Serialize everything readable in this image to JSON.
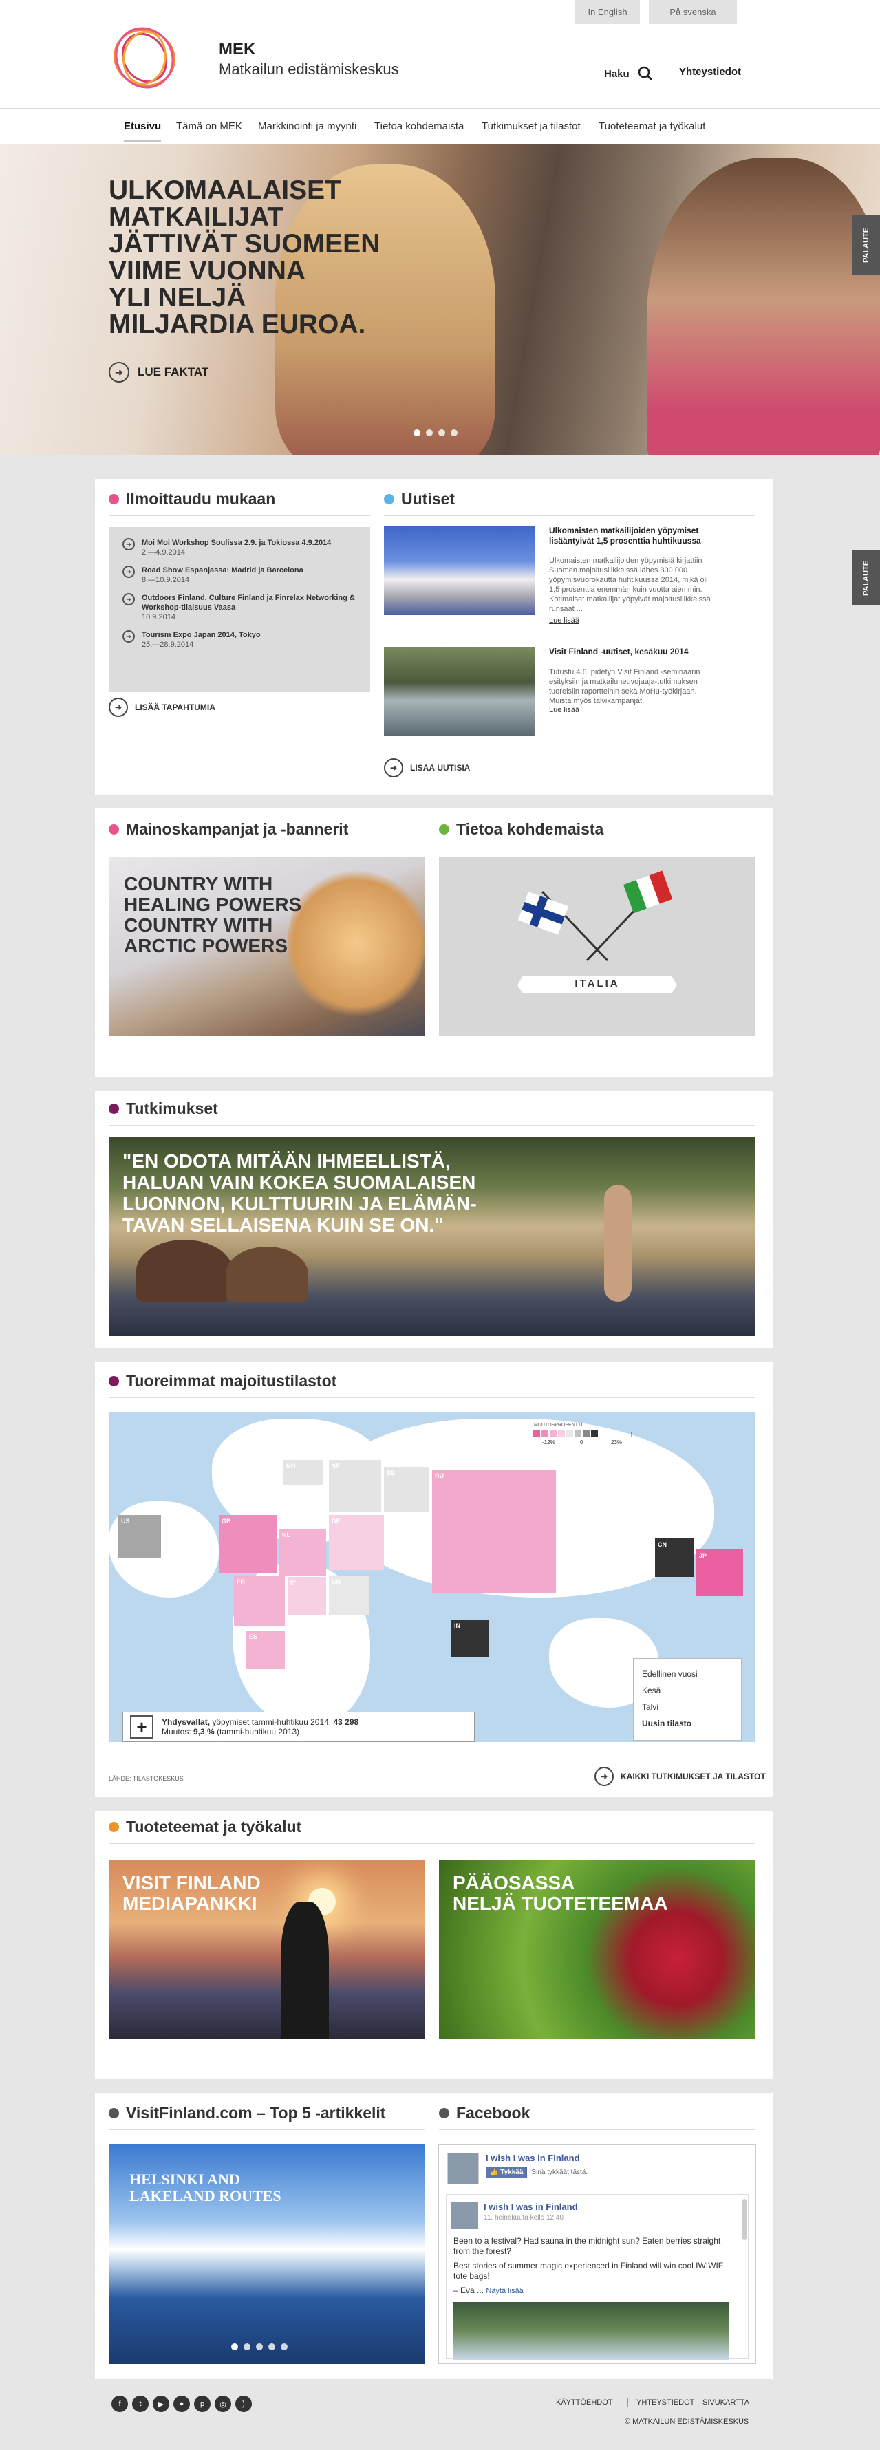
{
  "lang": {
    "english": "In English",
    "swedish": "På svenska"
  },
  "brand": {
    "name": "MEK",
    "tagline": "Matkailun edistämiskeskus"
  },
  "header": {
    "search_label": "Haku",
    "contact_label": "Yhteystiedot"
  },
  "nav": [
    "Etusivu",
    "Tämä on MEK",
    "Markkinointi ja myynti",
    "Tietoa kohdemaista",
    "Tutkimukset ja tilastot",
    "Tuoteteemat ja työkalut"
  ],
  "hero": {
    "title": "ULKOMAALAISET\nMATKAILIJAT\nJÄTTIVÄT SUOMEEN\nVIIME VUONNA\nYLI NELJÄ\nMILJARDIA EUROA.",
    "cta": "LUE FAKTAT"
  },
  "feedback_label": "PALAUTE",
  "events": {
    "title": "Ilmoittaudu mukaan",
    "items": [
      {
        "title": "Moi Moi Workshop Soulissa 2.9. ja Tokiossa 4.9.2014",
        "date": "2.—4.9.2014"
      },
      {
        "title": "Road Show Espanjassa: Madrid ja Barcelona",
        "date": "8.—10.9.2014"
      },
      {
        "title": "Outdoors Finland, Culture Finland ja Finrelax Networking & Workshop-tilaisuus Vaasa",
        "date": "10.9.2014"
      },
      {
        "title": "Tourism Expo Japan 2014, Tokyo",
        "date": "25.—28.9.2014"
      }
    ],
    "more": "LISÄÄ TAPAHTUMIA"
  },
  "news": {
    "title": "Uutiset",
    "items": [
      {
        "title": "Ulkomaisten matkailijoiden yöpymiset lisääntyivät 1,5 prosenttia huhtikuussa",
        "body": "Ulkomaisten matkailijoiden yöpymisiä kirjattiin Suomen majoitusliikkeissä lähes 300 000 yöpymisvuorokautta huhtikuussa 2014, mikä oli 1,5 prosenttia enemmän kuin vuotta aiemmin. Kotimaiset matkailijat yöpyivät majoitusliikkeissä runsaat ...",
        "link": "Lue lisää"
      },
      {
        "title": "Visit Finland -uutiset, kesäkuu 2014",
        "body": "Tutustu 4.6. pidetyn Visit Finland -seminaarin esityksiin ja matkailuneuvojaaja-tutkimuksen tuoreisiin raportteihin sekä MoHu-työkirjaan. Muista myös talvikampanjat.",
        "link": "Lue lisää"
      }
    ],
    "more": "LISÄÄ UUTISIA"
  },
  "campaigns": {
    "title": "Mainoskampanjat ja -bannerit",
    "tile_text": "COUNTRY WITH\nHEALING POWERS\nCOUNTRY WITH\nARCTIC POWERS"
  },
  "destinations": {
    "title": "Tietoa kohdemaista",
    "country": "ITALIA"
  },
  "research": {
    "title": "Tutkimukset",
    "quote": "\"EN ODOTA MITÄÄN IHMEELLISTÄ,\nHALUAN VAIN KOKEA SUOMALAISEN\nLUONNON, KULTTUURIN JA ELÄMÄN-\nTAVAN SELLAISENA KUIN SE ON.\""
  },
  "stats": {
    "title": "Tuoreimmat majoitustilastot",
    "legend_title": "MUUTOSPROSENTTI",
    "legend_min": "-12%",
    "legend_mid": "0",
    "legend_max": "23%",
    "countries": [
      "NO",
      "SE",
      "EE",
      "RU",
      "US",
      "GB",
      "DE",
      "NL",
      "FR",
      "CH",
      "IT",
      "ES",
      "CN",
      "JP",
      "IN"
    ],
    "filters": [
      "Edellinen vuosi",
      "Kesä",
      "Talvi",
      "Uusin tilasto"
    ],
    "summary_label": "Yhdysvallat,",
    "summary_text": "yöpymiset tammi-huhtikuu 2014:",
    "summary_value": "43 298",
    "change_label": "Muutos:",
    "change_value": "9,3 %",
    "change_period": "(tammi-huhtikuu 2013)",
    "source": "LÄHDE: TILASTOKESKUS",
    "more": "KAIKKI TUTKIMUKSET JA TILASTOT"
  },
  "themes": {
    "title": "Tuoteteemat ja työkalut",
    "tile1": "VISIT FINLAND\nMEDIAPANKKI",
    "tile2": "PÄÄOSASSA\nNELJÄ TUOTETEEMAA"
  },
  "top5": {
    "title": "VisitFinland.com – Top 5 -artikkelit",
    "tile": "HELSINKI AND\nLAKELAND ROUTES"
  },
  "facebook": {
    "title": "Facebook",
    "page_name": "I wish I was in Finland",
    "like": "Tykkää",
    "like_text": "Sinä tykkäät tästä.",
    "post_name": "I wish I was in Finland",
    "post_time": "11. heinäkuuta kello 12:40",
    "post_text1": "Been to a festival? Had sauna in the midnight sun? Eaten berries straight from the forest?",
    "post_text2": "Best stories of summer magic experienced in Finland will win cool IWIWIF tote bags!",
    "post_more": "– Eva ...",
    "see_more": "Näytä lisää"
  },
  "footer": {
    "links": [
      "KÄYTTÖEHDOT",
      "YHTEYSTIEDOT",
      "SIVUKARTTA"
    ],
    "copyright": "© MATKAILUN EDISTÄMISKESKUS"
  },
  "colors": {
    "pink": "#e8528e",
    "blue": "#5bb3e8",
    "green": "#6cb33f",
    "purple": "#7a1b5b",
    "orange": "#f0922a",
    "dark": "#555555"
  }
}
